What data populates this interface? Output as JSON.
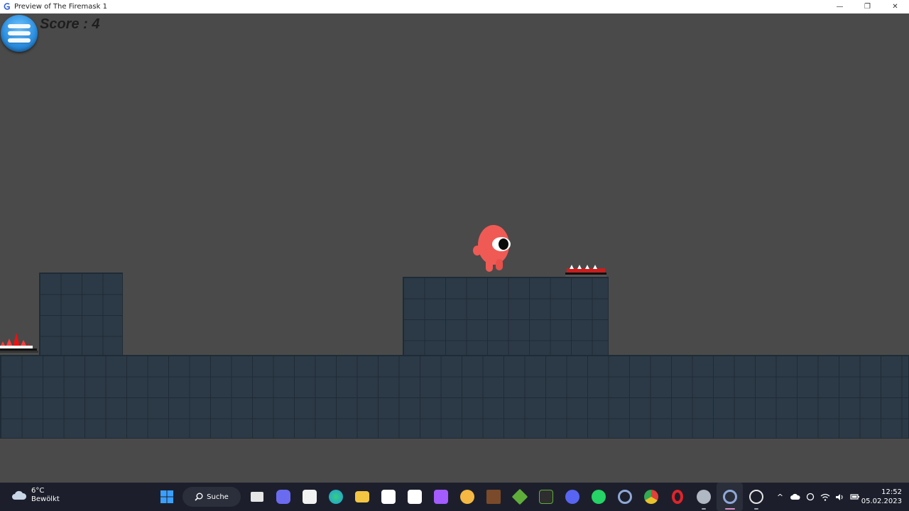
{
  "window": {
    "title": "Preview of The Firemask 1",
    "controls": {
      "minimize": "—",
      "restore": "❐",
      "close": "✕"
    }
  },
  "game": {
    "score_text": "Score : 4",
    "colors": {
      "background": "#4a4a4a",
      "tile": "#2c3a47",
      "player": "#f05a55",
      "spikes": "#d11f1f",
      "menu_button": "#2c8fe0"
    }
  },
  "taskbar": {
    "weather": {
      "temperature": "6°C",
      "condition": "Bewölkt"
    },
    "search_label": "Suche",
    "apps": [
      {
        "name": "windows-start-icon",
        "color": "#3aa0ff"
      },
      {
        "name": "task-view-icon",
        "color": "#e6e6e6"
      },
      {
        "name": "teams-chat-icon",
        "color": "#6b6bf0"
      },
      {
        "name": "store-icon",
        "color": "#f2f2f2"
      },
      {
        "name": "edge-icon",
        "color": "#1f9be0"
      },
      {
        "name": "file-explorer-icon",
        "color": "#f4c542"
      },
      {
        "name": "amazon-icon",
        "color": "#ffffff"
      },
      {
        "name": "capcut-icon",
        "color": "#ffffff"
      },
      {
        "name": "clipchamp-icon",
        "color": "#a45cff"
      },
      {
        "name": "speedcrunch-icon",
        "color": "#f5b842"
      },
      {
        "name": "minecraft-dungeons-icon",
        "color": "#7a4a2a"
      },
      {
        "name": "minecraft-icon",
        "color": "#5fae3a"
      },
      {
        "name": "minecraft-launcher-icon",
        "color": "#2e2e2e"
      },
      {
        "name": "discord-icon",
        "color": "#5865f2"
      },
      {
        "name": "whatsapp-icon",
        "color": "#25d366"
      },
      {
        "name": "gdevelop-icon",
        "color": "#8fa8d8"
      },
      {
        "name": "chrome-icon",
        "color": "#e8c22c"
      },
      {
        "name": "opera-icon",
        "color": "#e0242a"
      },
      {
        "name": "settings-icon",
        "color": "#b0b8c4"
      },
      {
        "name": "gdevelop-active-icon",
        "color": "#8fa8d8"
      },
      {
        "name": "obs-icon",
        "color": "#e5e5e5"
      }
    ],
    "tray": {
      "chevron": "^",
      "time": "12:52",
      "date": "05.02.2023"
    }
  }
}
